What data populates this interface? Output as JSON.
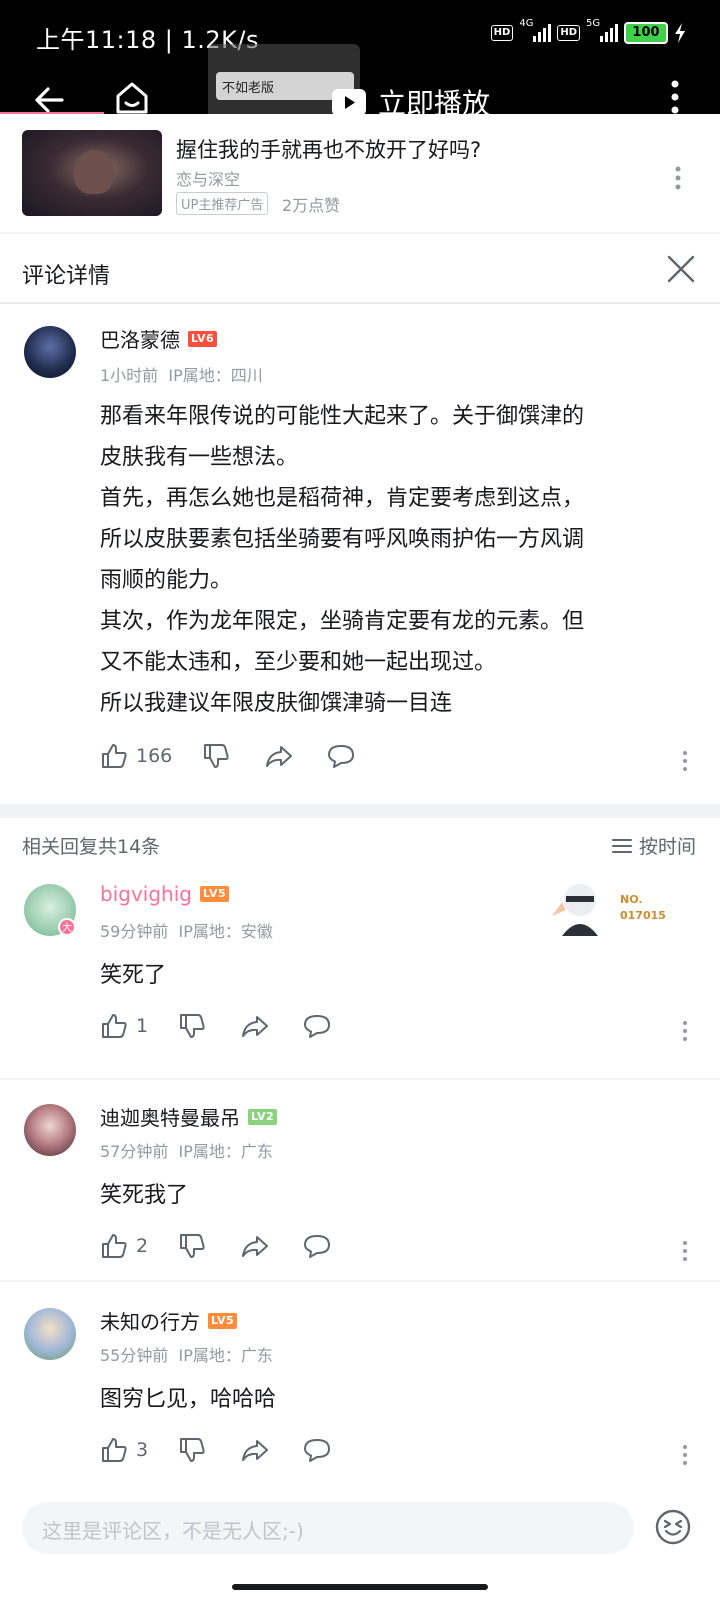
{
  "status_bar": {
    "time": "上午11:18",
    "net_speed": "1.2K/s",
    "hd1": "HD",
    "gen1": "4G",
    "hd2": "HD",
    "gen2": "5G",
    "battery": "100"
  },
  "video_bar": {
    "thumb_label": "不如老版",
    "play_label": "立即播放"
  },
  "ad": {
    "title": "握住我的手就再也不放开了好吗?",
    "channel": "恋与深空",
    "tag": "UP主推荐广告",
    "likes": "2万点赞"
  },
  "header": {
    "title": "评论详情"
  },
  "main_comment": {
    "user": "巴洛蒙德",
    "level": "LV6",
    "time": "1小时前",
    "ip": "IP属地：四川",
    "text_lines": [
      "那看来年限传说的可能性大起来了。关于御馔津的",
      "皮肤我有一些想法。",
      "首先，再怎么她也是稻荷神，肯定要考虑到这点，",
      "所以皮肤要素包括坐骑要有呼风唤雨护佑一方风调",
      "雨顺的能力。",
      "其次，作为龙年限定，坐骑肯定要有龙的元素。但",
      "又不能太违和，至少要和她一起出现过。",
      "所以我建议年限皮肤御馔津骑一目连"
    ],
    "likes": "166"
  },
  "replies_header": {
    "count_label": "相关回复共14条",
    "sort_label": "按时间"
  },
  "medal": {
    "line1": "NO.",
    "line2": "017015"
  },
  "replies": [
    {
      "user": "bigvighig",
      "level": "LV5",
      "time": "59分钟前",
      "ip": "IP属地：安徽",
      "text": "笑死了",
      "likes": "1"
    },
    {
      "user": "迪迦奥特曼最吊",
      "level": "LV2",
      "time": "57分钟前",
      "ip": "IP属地：广东",
      "text": "笑死我了",
      "likes": "2"
    },
    {
      "user": "未知の行方",
      "level": "LV5",
      "time": "55分钟前",
      "ip": "IP属地：广东",
      "text": "图穷匕见，哈哈哈",
      "likes": "3"
    }
  ],
  "input": {
    "placeholder": "这里是评论区，不是无人区;-)"
  },
  "colors": {
    "accent_pink": "#fb7299",
    "lv6": "#ff4f3c",
    "lv5": "#ff8c3a",
    "lv2": "#8bd27d",
    "battery": "#3fd14a"
  }
}
